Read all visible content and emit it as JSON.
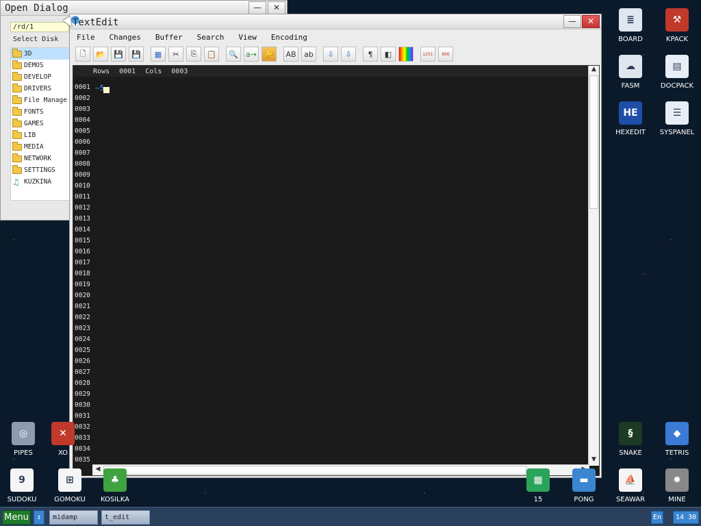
{
  "open_dialog": {
    "title": "Open Dialog",
    "path": "/rd/1",
    "select_disk_label": "Select Disk",
    "minimize": "—",
    "close": "✕",
    "items": [
      {
        "label": "3D",
        "icon": "folder"
      },
      {
        "label": "DEMOS",
        "icon": "folder"
      },
      {
        "label": "DEVELOP",
        "icon": "folder"
      },
      {
        "label": "DRIVERS",
        "icon": "folder"
      },
      {
        "label": "File Manage",
        "icon": "folder"
      },
      {
        "label": "FONTS",
        "icon": "folder"
      },
      {
        "label": "GAMES",
        "icon": "folder"
      },
      {
        "label": "LIB",
        "icon": "folder"
      },
      {
        "label": "MEDIA",
        "icon": "folder"
      },
      {
        "label": "NETWORK",
        "icon": "folder"
      },
      {
        "label": "SETTINGS",
        "icon": "folder"
      },
      {
        "label": "KUZKINA",
        "icon": "music"
      }
    ]
  },
  "textedit": {
    "title": "TextEdit",
    "minimize": "—",
    "close": "✕",
    "menu": [
      "File",
      "Changes",
      "Buffer",
      "Search",
      "View",
      "Encoding"
    ],
    "status": {
      "rows_label": "Rows",
      "rows_value": "0001",
      "cols_label": "Cols",
      "cols_value": "0003"
    },
    "line_numbers": [
      "0001",
      "0002",
      "0003",
      "0004",
      "0005",
      "0006",
      "0007",
      "0008",
      "0009",
      "0010",
      "0011",
      "0012",
      "0013",
      "0014",
      "0015",
      "0016",
      "0017",
      "0018",
      "0019",
      "0020",
      "0021",
      "0022",
      "0023",
      "0024",
      "0025",
      "0026",
      "0027",
      "0028",
      "0029",
      "0030",
      "0031",
      "0032",
      "0033",
      "0034",
      "0035"
    ],
    "content_glyph": "~5",
    "toolbar": [
      {
        "name": "new-file-icon",
        "glyph": "🗋"
      },
      {
        "name": "open-folder-icon",
        "glyph": "📂"
      },
      {
        "name": "save-icon",
        "glyph": "💾"
      },
      {
        "name": "save-as-icon",
        "glyph": "💾"
      },
      {
        "name": "select-all-icon",
        "glyph": "▦"
      },
      {
        "name": "cut-icon",
        "glyph": "✂"
      },
      {
        "name": "copy-icon",
        "glyph": "⎘"
      },
      {
        "name": "paste-icon",
        "glyph": "📋"
      },
      {
        "name": "find-icon",
        "glyph": "🔍"
      },
      {
        "name": "replace-icon",
        "glyph": "a→"
      },
      {
        "name": "key-icon",
        "glyph": "🔑"
      },
      {
        "name": "uppercase-icon",
        "glyph": "AB"
      },
      {
        "name": "lowercase-icon",
        "glyph": "ab"
      },
      {
        "name": "collapse-icon",
        "glyph": "⇩"
      },
      {
        "name": "expand-icon",
        "glyph": "⇩"
      },
      {
        "name": "pilcrow-icon",
        "glyph": "¶"
      },
      {
        "name": "color-scheme-icon",
        "glyph": "◧"
      },
      {
        "name": "syntax-colors-icon",
        "glyph": "≡"
      },
      {
        "name": "convert-1251-866-icon",
        "glyph": "1251"
      },
      {
        "name": "convert-866-1251-icon",
        "glyph": "866"
      }
    ]
  },
  "desktop_icons": [
    {
      "label": "BOARD",
      "color": "#dfe6ee",
      "glyph": "≣"
    },
    {
      "label": "KPACK",
      "color": "#c0392b",
      "glyph": "⚒"
    },
    {
      "label": "FASM",
      "color": "#dfe6ee",
      "glyph": "☁"
    },
    {
      "label": "DOCPACK",
      "color": "#e8eef5",
      "glyph": "▤"
    },
    {
      "label": "HEXEDIT",
      "color": "#1e4ea8",
      "glyph": "HE"
    },
    {
      "label": "SYSPANEL",
      "color": "#e8eef5",
      "glyph": "☰"
    },
    {
      "label": "PIPES",
      "color": "#8e9ab0",
      "glyph": "◎"
    },
    {
      "label": "XO",
      "color": "#c0392b",
      "glyph": "✕"
    },
    {
      "label": "SNAKE",
      "color": "#1d3b24",
      "glyph": "§"
    },
    {
      "label": "TETRIS",
      "color": "#3a7bd5",
      "glyph": "◆"
    },
    {
      "label": "SUDOKU",
      "color": "#f5f5f5",
      "glyph": "9"
    },
    {
      "label": "GOMOKU",
      "color": "#f5f5f5",
      "glyph": "⊞"
    },
    {
      "label": "KOSILKA",
      "color": "#3fa33f",
      "glyph": "♣"
    },
    {
      "label": "15",
      "color": "#2aa35b",
      "glyph": "▦"
    },
    {
      "label": "PONG",
      "color": "#3b86d1",
      "glyph": "▬"
    },
    {
      "label": "SEAWAR",
      "color": "#f5f5f5",
      "glyph": "⛵"
    },
    {
      "label": "MINE",
      "color": "#888888",
      "glyph": "✹"
    }
  ],
  "taskbar": {
    "menu_label": "Menu",
    "switch_glyph": "↕",
    "tasks": [
      "midamp",
      "t_edit"
    ],
    "lang": "En",
    "clock": "14 30"
  }
}
